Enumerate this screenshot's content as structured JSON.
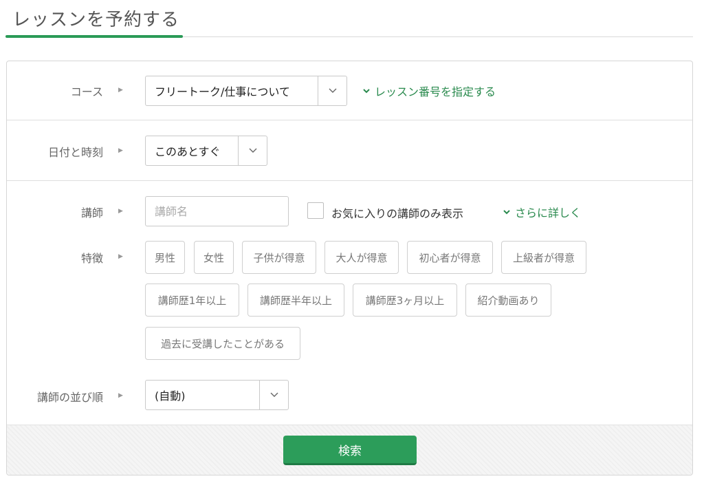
{
  "page": {
    "title": "レッスンを予約する"
  },
  "course": {
    "label": "コース",
    "selected": "フリートーク/仕事について",
    "link": "レッスン番号を指定する"
  },
  "datetime": {
    "label": "日付と時刻",
    "selected": "このあとすぐ"
  },
  "teacher": {
    "label": "講師",
    "placeholder": "講師名",
    "favorites_label": "お気に入りの講師のみ表示",
    "more_link": "さらに詳しく"
  },
  "features": {
    "label": "特徴",
    "tags": [
      "男性",
      "女性",
      "子供が得意",
      "大人が得意",
      "初心者が得意",
      "上級者が得意",
      "講師歴1年以上",
      "講師歴半年以上",
      "講師歴3ヶ月以上",
      "紹介動画あり",
      "過去に受講したことがある"
    ]
  },
  "sort": {
    "label": "講師の並び順",
    "selected": "(自動)"
  },
  "footer": {
    "search_label": "検索"
  },
  "colors": {
    "accent": "#2a9a57",
    "link": "#2a8a4e",
    "button": "#2c9d5a"
  },
  "icons": {
    "row_marker": "triangle-right-icon",
    "dropdown": "chevron-down-icon",
    "link_marker": "chevron-down-icon"
  }
}
